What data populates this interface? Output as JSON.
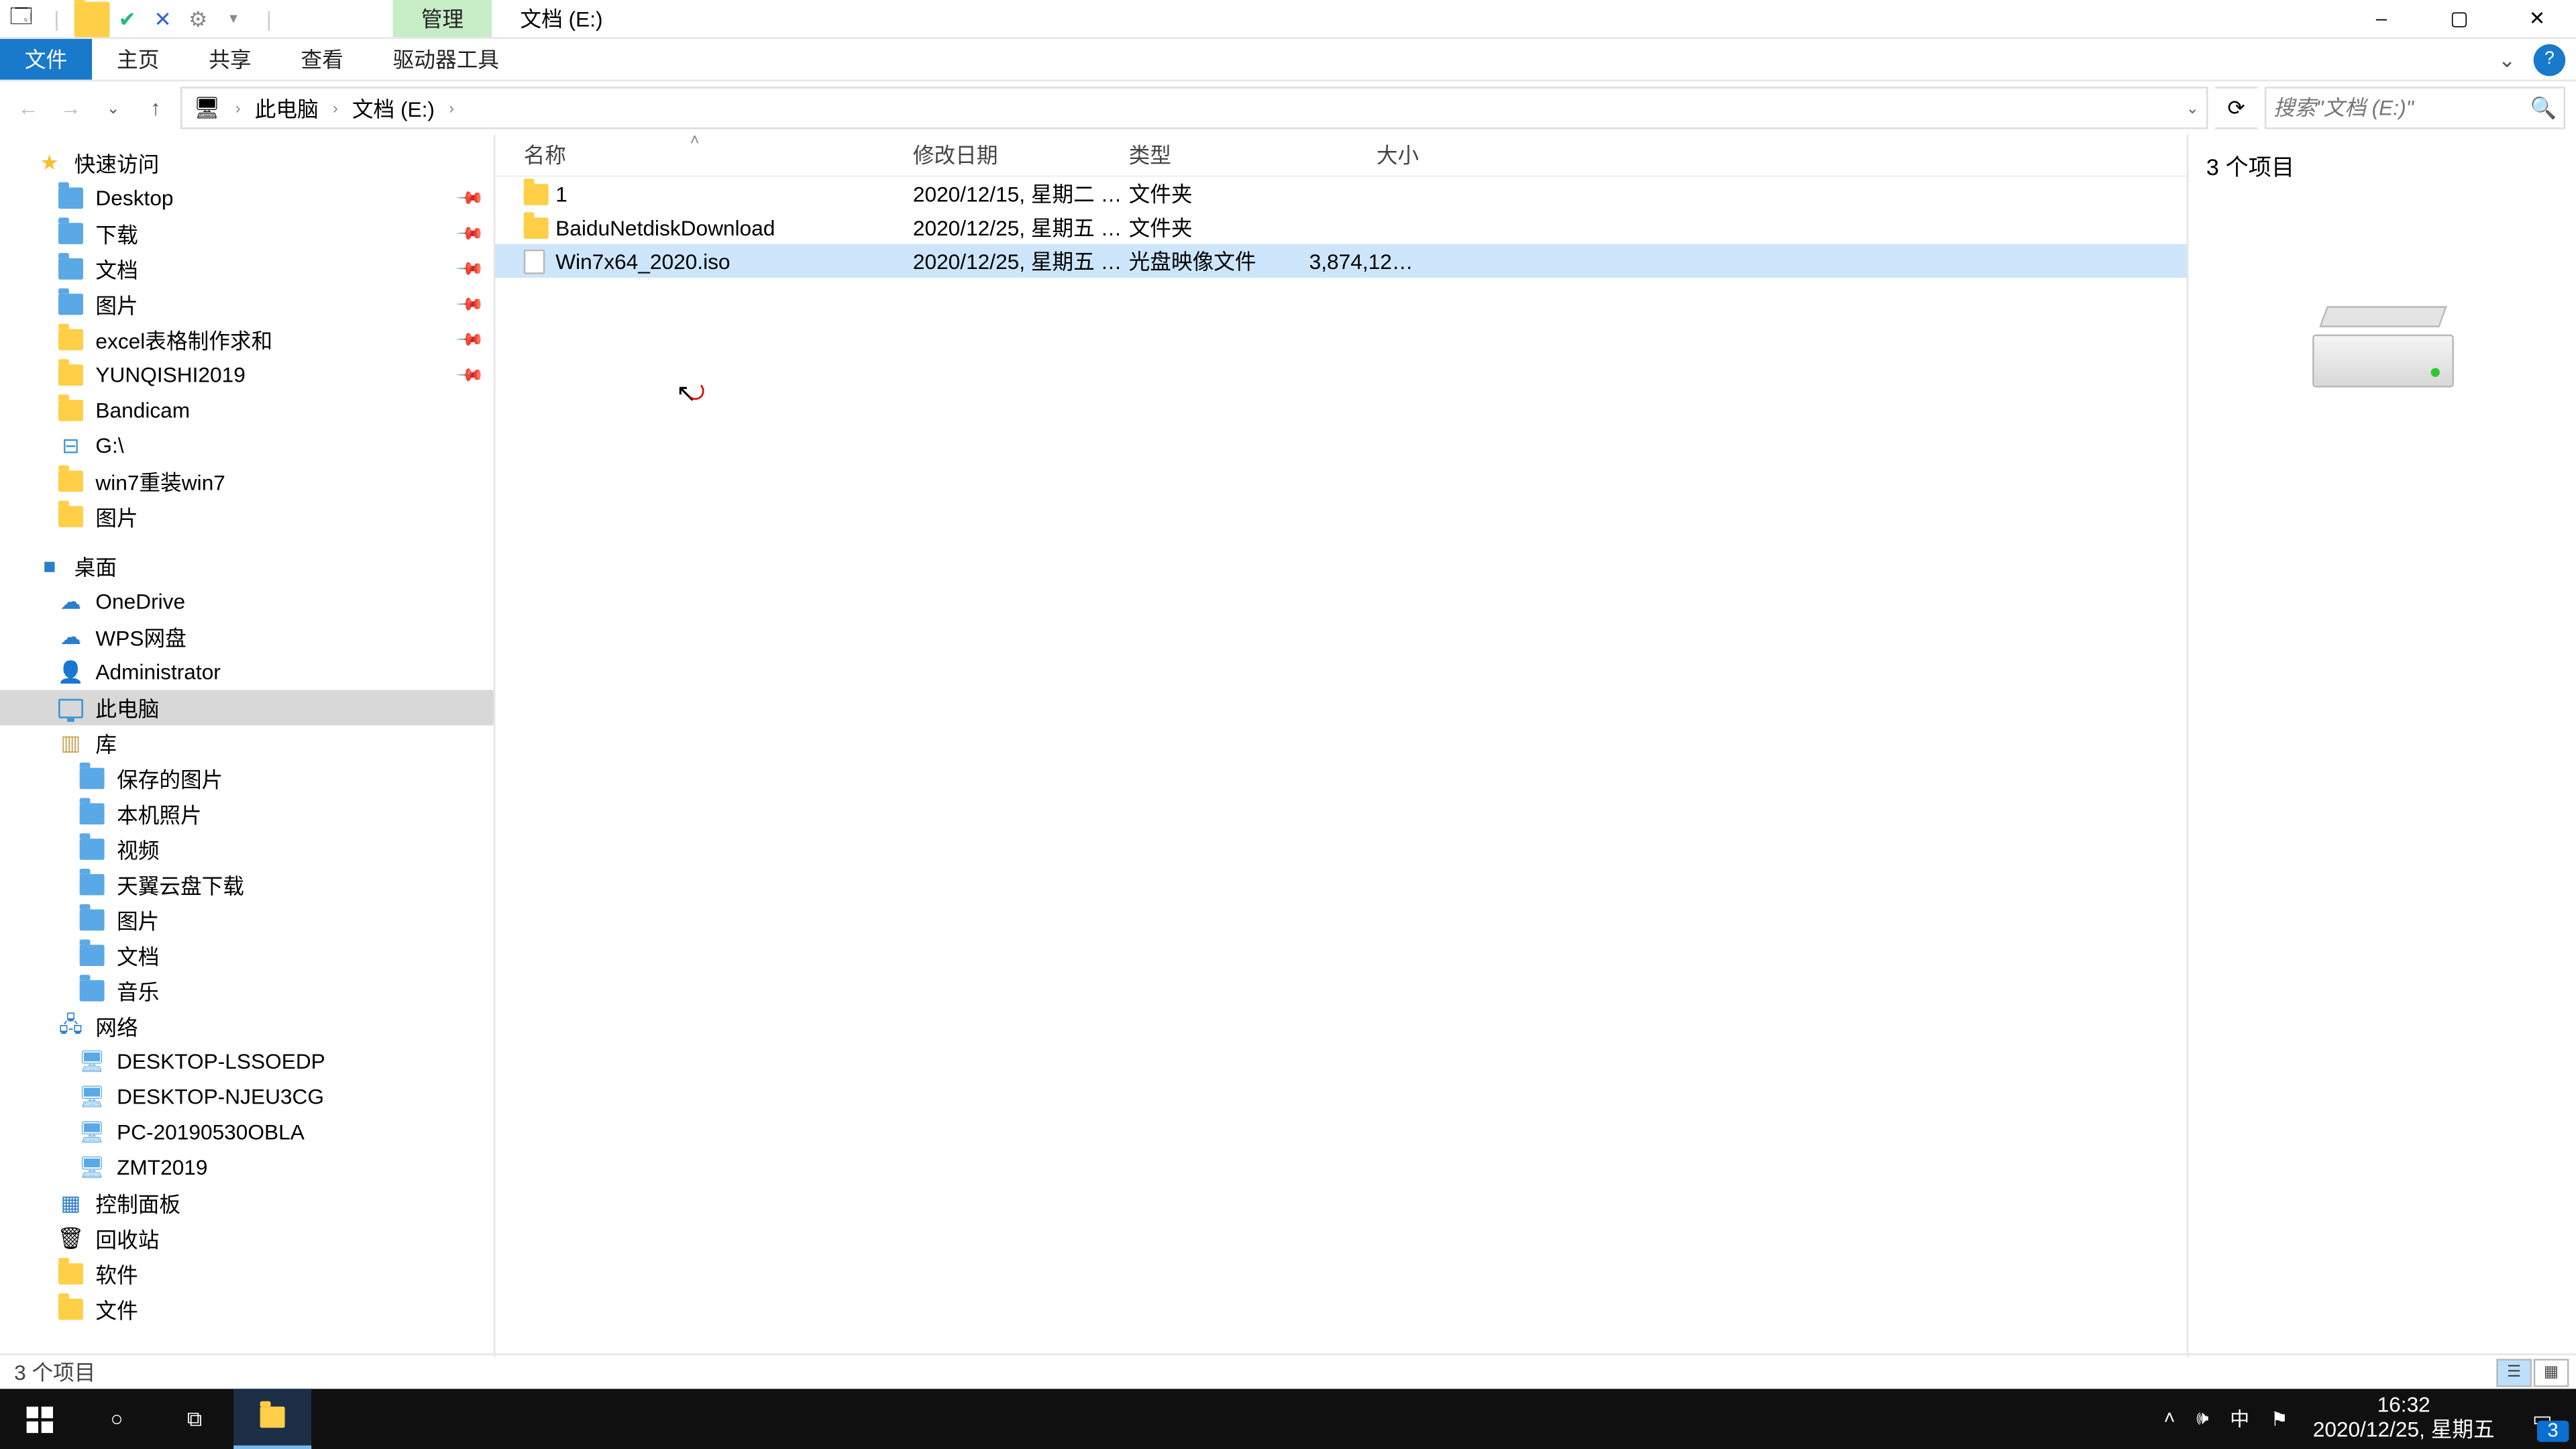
{
  "titlebar": {
    "contextual_tab": "管理",
    "window_title": "文档 (E:)",
    "min_tip": "–",
    "max_tip": "▢",
    "close_tip": "✕"
  },
  "ribbon": {
    "file": "文件",
    "home": "主页",
    "share": "共享",
    "view": "查看",
    "drive_tools": "驱动器工具"
  },
  "nav": {
    "back": "←",
    "forward": "→",
    "recent": "⌄",
    "up": "↑"
  },
  "breadcrumb": {
    "root_icon": "🖥",
    "items": [
      "此电脑",
      "文档 (E:)"
    ],
    "sep": "›",
    "dropdown": "⌄"
  },
  "refresh_icon": "⟳",
  "search": {
    "placeholder": "搜索\"文档 (E:)\""
  },
  "columns": {
    "name": "名称",
    "date": "修改日期",
    "type": "类型",
    "size": "大小"
  },
  "rows": [
    {
      "icon": "folder",
      "name": "1",
      "date": "2020/12/15, 星期二 1...",
      "type": "文件夹",
      "size": ""
    },
    {
      "icon": "folder",
      "name": "BaiduNetdiskDownload",
      "date": "2020/12/25, 星期五 1...",
      "type": "文件夹",
      "size": ""
    },
    {
      "icon": "file",
      "name": "Win7x64_2020.iso",
      "date": "2020/12/25, 星期五 1...",
      "type": "光盘映像文件",
      "size": "3,874,126...",
      "selected": true
    }
  ],
  "preview": {
    "header": "3 个项目"
  },
  "status": {
    "text": "3 个项目"
  },
  "tree": [
    {
      "kind": "item",
      "depth": 0,
      "icon": "star-blue",
      "label": "快速访问"
    },
    {
      "kind": "item",
      "depth": 1,
      "icon": "folder-blue",
      "label": "Desktop",
      "pin": true
    },
    {
      "kind": "item",
      "depth": 1,
      "icon": "folder-blue",
      "label": "下载",
      "pin": true
    },
    {
      "kind": "item",
      "depth": 1,
      "icon": "folder-blue",
      "label": "文档",
      "pin": true
    },
    {
      "kind": "item",
      "depth": 1,
      "icon": "folder-blue",
      "label": "图片",
      "pin": true
    },
    {
      "kind": "item",
      "depth": 1,
      "icon": "folder",
      "label": "excel表格制作求和",
      "pin": true
    },
    {
      "kind": "item",
      "depth": 1,
      "icon": "folder",
      "label": "YUNQISHI2019",
      "pin": true
    },
    {
      "kind": "item",
      "depth": 1,
      "icon": "folder",
      "label": "Bandicam"
    },
    {
      "kind": "item",
      "depth": 1,
      "icon": "drive",
      "label": "G:\\"
    },
    {
      "kind": "item",
      "depth": 1,
      "icon": "folder",
      "label": "win7重装win7"
    },
    {
      "kind": "item",
      "depth": 1,
      "icon": "folder",
      "label": "图片"
    },
    {
      "kind": "spacer"
    },
    {
      "kind": "item",
      "depth": 0,
      "icon": "desktop",
      "label": "桌面"
    },
    {
      "kind": "item",
      "depth": 1,
      "icon": "cloud",
      "label": "OneDrive"
    },
    {
      "kind": "item",
      "depth": 1,
      "icon": "cloud",
      "label": "WPS网盘"
    },
    {
      "kind": "item",
      "depth": 1,
      "icon": "user",
      "label": "Administrator"
    },
    {
      "kind": "item",
      "depth": 1,
      "icon": "pc",
      "label": "此电脑",
      "selected": true
    },
    {
      "kind": "item",
      "depth": 1,
      "icon": "library",
      "label": "库"
    },
    {
      "kind": "item",
      "depth": 2,
      "icon": "folder-blue",
      "label": "保存的图片"
    },
    {
      "kind": "item",
      "depth": 2,
      "icon": "folder-blue",
      "label": "本机照片"
    },
    {
      "kind": "item",
      "depth": 2,
      "icon": "folder-blue",
      "label": "视频"
    },
    {
      "kind": "item",
      "depth": 2,
      "icon": "folder-blue",
      "label": "天翼云盘下载"
    },
    {
      "kind": "item",
      "depth": 2,
      "icon": "folder-blue",
      "label": "图片"
    },
    {
      "kind": "item",
      "depth": 2,
      "icon": "folder-blue",
      "label": "文档"
    },
    {
      "kind": "item",
      "depth": 2,
      "icon": "folder-blue",
      "label": "音乐"
    },
    {
      "kind": "item",
      "depth": 1,
      "icon": "network",
      "label": "网络"
    },
    {
      "kind": "item",
      "depth": 2,
      "icon": "pc-net",
      "label": "DESKTOP-LSSOEDP"
    },
    {
      "kind": "item",
      "depth": 2,
      "icon": "pc-net",
      "label": "DESKTOP-NJEU3CG"
    },
    {
      "kind": "item",
      "depth": 2,
      "icon": "pc-net",
      "label": "PC-20190530OBLA"
    },
    {
      "kind": "item",
      "depth": 2,
      "icon": "pc-net",
      "label": "ZMT2019"
    },
    {
      "kind": "item",
      "depth": 1,
      "icon": "panel",
      "label": "控制面板"
    },
    {
      "kind": "item",
      "depth": 1,
      "icon": "recycle",
      "label": "回收站"
    },
    {
      "kind": "item",
      "depth": 1,
      "icon": "folder",
      "label": "软件"
    },
    {
      "kind": "item",
      "depth": 1,
      "icon": "folder",
      "label": "文件"
    }
  ],
  "taskbar": {
    "tray": {
      "ime": "中",
      "time": "16:32",
      "date": "2020/12/25, 星期五",
      "notif_count": "3"
    }
  }
}
